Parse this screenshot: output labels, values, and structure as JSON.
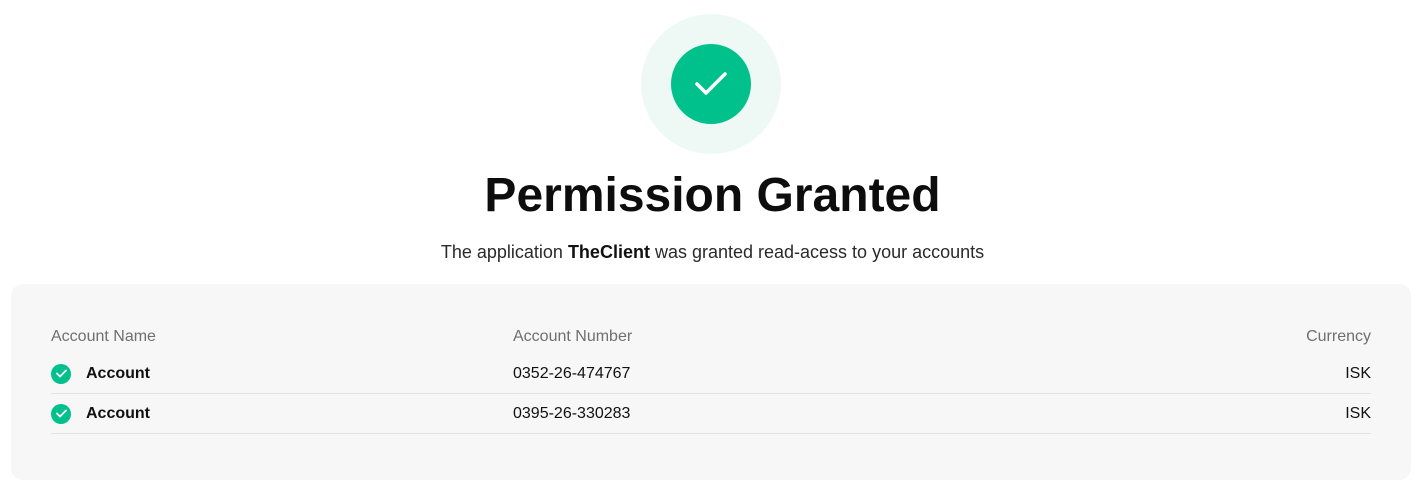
{
  "status": {
    "icon": "check-icon",
    "title": "Permission Granted",
    "message_prefix": "The application ",
    "app_name": "TheClient",
    "message_suffix": " was granted read-acess to your accounts"
  },
  "colors": {
    "accent": "#00c08b",
    "badge_bg": "#eef9f6",
    "panel_bg": "#f7f7f7"
  },
  "accounts_table": {
    "columns": {
      "name": "Account Name",
      "number": "Account Number",
      "currency": "Currency"
    },
    "rows": [
      {
        "icon": "check-icon",
        "name": "Account",
        "number": "0352-26-474767",
        "currency": "ISK"
      },
      {
        "icon": "check-icon",
        "name": "Account",
        "number": "0395-26-330283",
        "currency": "ISK"
      }
    ]
  }
}
